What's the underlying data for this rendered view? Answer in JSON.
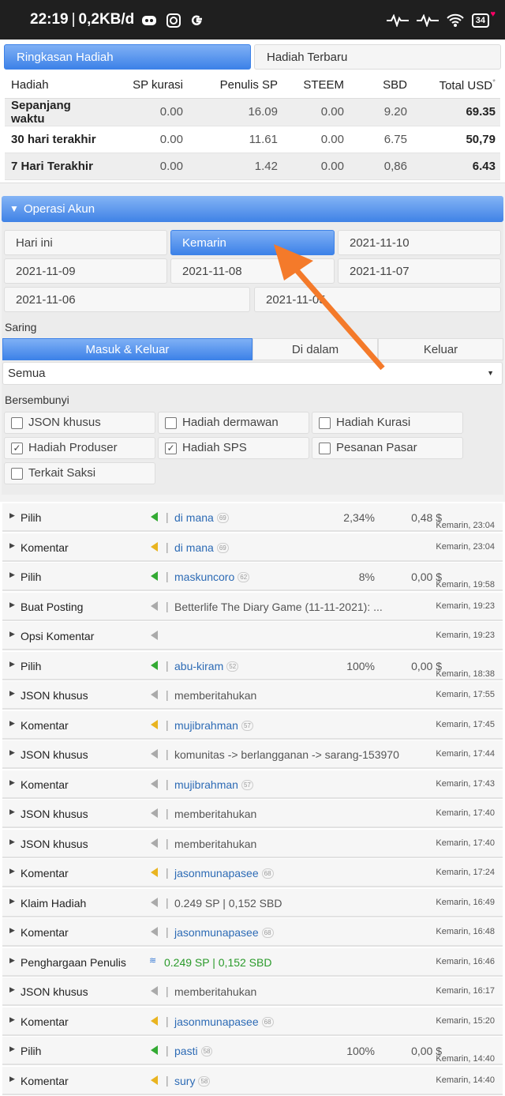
{
  "statusbar": {
    "time": "22:19",
    "speed": "0,2KB/d",
    "battery": "34",
    "icons": [
      "discord-icon",
      "instagram-icon",
      "google-icon",
      "wave-icon",
      "wave-icon",
      "wifi-icon",
      "battery-icon"
    ]
  },
  "rewards": {
    "tab_summary": "Ringkasan Hadiah",
    "tab_latest": "Hadiah Terbaru",
    "columns": [
      "Hadiah",
      "SP kurasi",
      "Penulis SP",
      "STEEM",
      "SBD",
      "Total USD"
    ],
    "total_usd_mark": "*",
    "rows": [
      [
        "Sepanjang waktu",
        "0.00",
        "16.09",
        "0.00",
        "9.20",
        "69.35"
      ],
      [
        "30 hari terakhir",
        "0.00",
        "11.61",
        "0.00",
        "6.75",
        "50,79"
      ],
      [
        "7 Hari Terakhir",
        "0.00",
        "1.42",
        "0.00",
        "0,86",
        "6.43"
      ]
    ]
  },
  "ops": {
    "header": "Operasi Akun",
    "dates": [
      "Hari ini",
      "Kemarin",
      "2021-11-10",
      "2021-11-09",
      "2021-11-08",
      "2021-11-07",
      "2021-11-06",
      "2021-11-05"
    ],
    "filter_label": "Saring",
    "direction": [
      "Masuk & Keluar",
      "Di dalam",
      "Keluar"
    ],
    "select_value": "Semua",
    "hidden_label": "Bersembunyi",
    "checks": [
      {
        "label": "JSON khusus",
        "checked": ""
      },
      {
        "label": "Hadiah dermawan",
        "checked": ""
      },
      {
        "label": "Hadiah Kurasi",
        "checked": ""
      },
      {
        "label": "Hadiah Produser",
        "checked": "✓"
      },
      {
        "label": "Hadiah SPS",
        "checked": "✓"
      },
      {
        "label": "Pesanan Pasar",
        "checked": ""
      },
      {
        "label": "Terkait Saksi",
        "checked": ""
      }
    ],
    "list": [
      {
        "type": "Pilih",
        "vote": "green",
        "desc": "di mana",
        "rep": "69",
        "pct": "2,34%",
        "amt": "0,48 $",
        "time": "Kemarin, 23:04",
        "low": true
      },
      {
        "type": "Komentar",
        "vote": "yellow",
        "desc": "di mana",
        "rep": "69",
        "pct": "",
        "amt": "",
        "time": "Kemarin, 23:04",
        "low": false
      },
      {
        "type": "Pilih",
        "vote": "green",
        "desc": "maskuncoro",
        "rep": "62",
        "pct": "8%",
        "amt": "0,00 $",
        "time": "Kemarin, 19:58",
        "low": true
      },
      {
        "type": "Buat Posting",
        "vote": "gray",
        "desc": "Betterlife The Diary Game (11-11-2021): ...",
        "rep": "",
        "pct": "",
        "amt": "",
        "time": "Kemarin, 19:23",
        "low": false,
        "plain": true
      },
      {
        "type": "Opsi Komentar",
        "vote": "gray",
        "desc": "",
        "rep": "",
        "pct": "",
        "amt": "",
        "time": "Kemarin, 19:23",
        "low": false,
        "nopipe": true
      },
      {
        "type": "Pilih",
        "vote": "green",
        "desc": "abu-kiram",
        "rep": "52",
        "pct": "100%",
        "amt": "0,00 $",
        "time": "Kemarin, 18:38",
        "low": true
      },
      {
        "type": "JSON khusus",
        "vote": "gray",
        "desc": "memberitahukan",
        "rep": "",
        "pct": "",
        "amt": "",
        "time": "Kemarin, 17:55",
        "low": false,
        "plain": true
      },
      {
        "type": "Komentar",
        "vote": "yellow",
        "desc": "mujibrahman",
        "rep": "57",
        "pct": "",
        "amt": "",
        "time": "Kemarin, 17:45",
        "low": false
      },
      {
        "type": "JSON khusus",
        "vote": "gray",
        "desc": "komunitas -> berlangganan -> sarang-153970",
        "rep": "",
        "pct": "",
        "amt": "",
        "time": "Kemarin, 17:44",
        "low": false,
        "plain": true
      },
      {
        "type": "Komentar",
        "vote": "gray",
        "desc": "mujibrahman",
        "rep": "57",
        "pct": "",
        "amt": "",
        "time": "Kemarin, 17:43",
        "low": false
      },
      {
        "type": "JSON khusus",
        "vote": "gray",
        "desc": "memberitahukan",
        "rep": "",
        "pct": "",
        "amt": "",
        "time": "Kemarin, 17:40",
        "low": false,
        "plain": true
      },
      {
        "type": "JSON khusus",
        "vote": "gray",
        "desc": "memberitahukan",
        "rep": "",
        "pct": "",
        "amt": "",
        "time": "Kemarin, 17:40",
        "low": false,
        "plain": true
      },
      {
        "type": "Komentar",
        "vote": "yellow",
        "desc": "jasonmunapasee",
        "rep": "68",
        "pct": "",
        "amt": "",
        "time": "Kemarin, 17:24",
        "low": false
      },
      {
        "type": "Klaim Hadiah",
        "vote": "gray",
        "desc": "0.249 SP  |  0,152 SBD",
        "rep": "",
        "pct": "",
        "amt": "",
        "time": "Kemarin, 16:49",
        "low": false,
        "plain": true
      },
      {
        "type": "Komentar",
        "vote": "gray",
        "desc": "jasonmunapasee",
        "rep": "68",
        "pct": "",
        "amt": "",
        "time": "Kemarin, 16:48",
        "low": false
      },
      {
        "type": "Penghargaan Penulis",
        "vote": "blue",
        "desc": "0.249 SP  |  0,152 SBD",
        "rep": "",
        "pct": "",
        "amt": "",
        "time": "Kemarin, 16:46",
        "low": false,
        "green": true,
        "nopipe": true
      },
      {
        "type": "JSON khusus",
        "vote": "gray",
        "desc": "memberitahukan",
        "rep": "",
        "pct": "",
        "amt": "",
        "time": "Kemarin, 16:17",
        "low": false,
        "plain": true
      },
      {
        "type": "Komentar",
        "vote": "yellow",
        "desc": "jasonmunapasee",
        "rep": "68",
        "pct": "",
        "amt": "",
        "time": "Kemarin, 15:20",
        "low": false
      },
      {
        "type": "Pilih",
        "vote": "green",
        "desc": "pasti",
        "rep": "58",
        "pct": "100%",
        "amt": "0,00 $",
        "time": "Kemarin, 14:40",
        "low": true
      },
      {
        "type": "Komentar",
        "vote": "yellow",
        "desc": "sury",
        "rep": "58",
        "pct": "",
        "amt": "",
        "time": "Kemarin, 14:40",
        "low": false
      }
    ]
  },
  "colors": {
    "accent": "#3d82e8",
    "annotation_arrow": "#f47a2a"
  }
}
